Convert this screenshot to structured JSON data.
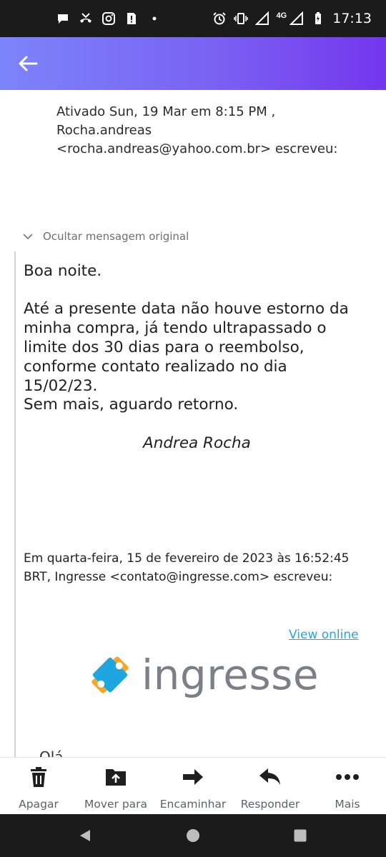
{
  "status_bar": {
    "time": "17:13",
    "network": "4G",
    "left_icons": [
      "chat-bubble-icon",
      "missed-call-icon",
      "instagram-icon",
      "alert-icon",
      "dot-icon"
    ],
    "right_icons": [
      "alarm-icon",
      "vibrate-icon",
      "signal-icon",
      "signal-icon",
      "battery-icon"
    ]
  },
  "app_bar": {
    "gradient": [
      "#7c84fb",
      "#7436ee"
    ],
    "back_icon": "arrow-left-icon"
  },
  "quote_header": {
    "line1": "Ativado Sun, 19 Mar em 8:15 PM ,",
    "line2": "Rocha.andreas",
    "line3": "<rocha.andreas@yahoo.com.br> escreveu:"
  },
  "toggle_original": {
    "label": "Ocultar mensagem original",
    "icon": "chevron-down-icon"
  },
  "message": {
    "greeting": "Boa noite.",
    "body": "Até a presente data não houve estorno da minha compra, já tendo ultrapassado o limite dos 30 dias para o reembolso, conforme contato realizado no dia 15/02/23.",
    "closing": "Sem mais,  aguardo retorno.",
    "signature": "Andrea Rocha"
  },
  "forwarded": {
    "header_line1": "Em quarta-feira, 15 de fevereiro de 2023 às 16:52:45",
    "header_line2": "BRT, Ingresse <contato@ingresse.com> escreveu:",
    "view_online": "View online",
    "logo_text": "ingresse",
    "cut_text": "Olá"
  },
  "actions": [
    {
      "label": "Apagar",
      "icon": "trash-icon"
    },
    {
      "label": "Mover para",
      "icon": "move-to-folder-icon"
    },
    {
      "label": "Encaminhar",
      "icon": "forward-icon"
    },
    {
      "label": "Responder",
      "icon": "reply-icon"
    },
    {
      "label": "Mais",
      "icon": "more-icon"
    }
  ],
  "nav_bar": [
    "back-triangle-icon",
    "home-circle-icon",
    "recents-square-icon"
  ]
}
